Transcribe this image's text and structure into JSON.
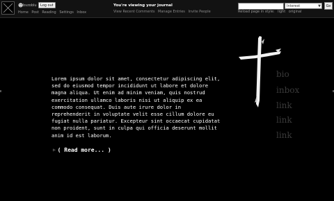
{
  "topbar": {
    "username": "bvzoblu",
    "logout_label": "Log out",
    "main_nav": [
      "Home",
      "Post",
      "Reading",
      "Settings",
      "Inbox"
    ],
    "viewing_title": "You're viewing your journal",
    "journal_links": [
      "View Recent Comments",
      "Manage Entries",
      "Invite People"
    ],
    "search": {
      "value": "",
      "select_value": "Interest",
      "go_label": "Go"
    },
    "style": {
      "label": "Reload page in style:",
      "options": [
        "light",
        "original"
      ]
    }
  },
  "entry": {
    "body": "Lorem ipsum dolor sit amet, consectetur adipiscing elit, sed do eiusmod tempor incididunt ut labore et dolore magna aliqua. Ut enim ad minim veniam, quis nostrud exercitation ullamco laboris nisi ut aliquip ex ea commodo consequat. Duis aute irure dolor in reprehenderit in voluptate velit esse cillum dolore eu fugiat nulla pariatur. Excepteur sint occaecat cupidatat non proident, sunt in culpa qui officia deserunt mollit anim id est laborum.",
    "read_more": "( Read more... )"
  },
  "side_nav": [
    "bio",
    "inbox",
    "link",
    "link",
    "link"
  ],
  "colors": {
    "background": "#000000",
    "side_nav_text": "#3a3a3a",
    "topbar": "#121212"
  },
  "icons": {
    "logo": "site-logo-icon",
    "user": "user-icon",
    "expand": "triangle-right-icon",
    "decoration": "cross-icon"
  }
}
